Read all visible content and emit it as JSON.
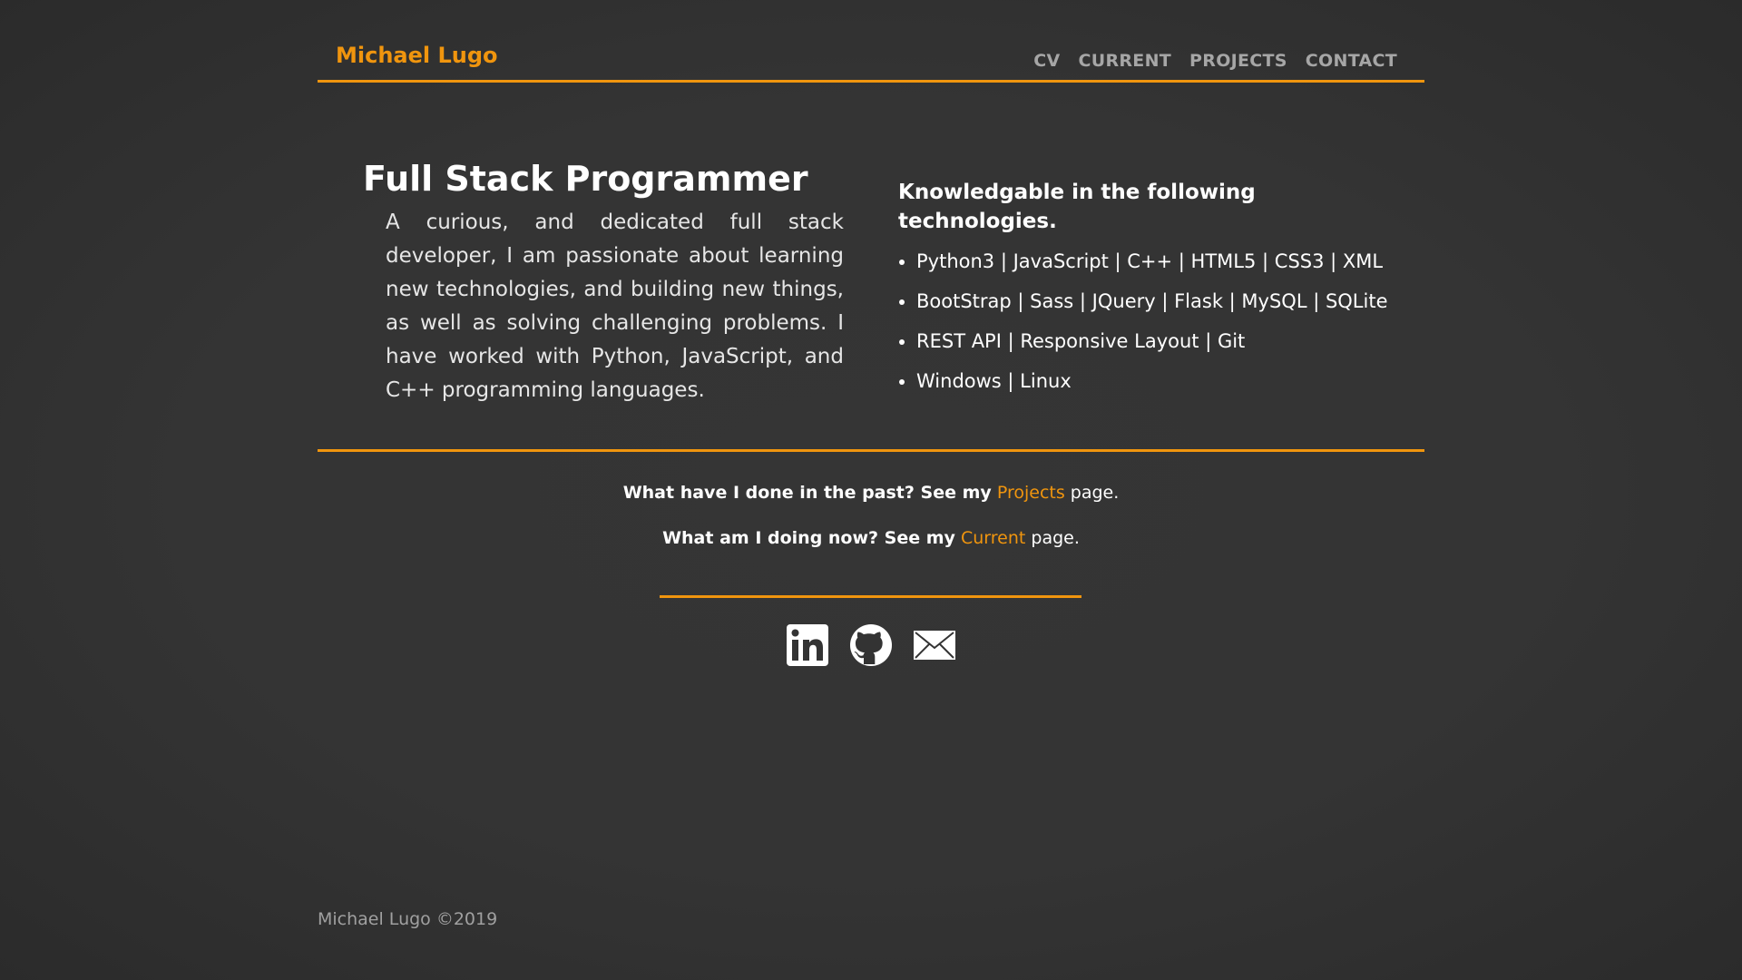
{
  "header": {
    "brand": "Michael Lugo",
    "nav": [
      "CV",
      "CURRENT",
      "PROJECTS",
      "CONTACT"
    ]
  },
  "intro": {
    "title": "Full Stack Programmer",
    "description": "A curious, and dedicated full stack developer, I am passionate about learning new technologies, and building new things, as well as solving challenging problems. I have worked with Python, JavaScript, and C++ programming languages."
  },
  "technologies": {
    "heading": "Knowledgable in the following technologies.",
    "items": [
      "Python3 | JavaScript | C++ | HTML5 | CSS3 | XML",
      "BootStrap | Sass | JQuery | Flask | MySQL | SQLite",
      "REST API | Responsive Layout | Git",
      "Windows | Linux"
    ]
  },
  "links": {
    "past": {
      "lead": "What have I done in the past? See my",
      "link": "Projects",
      "tail": "page."
    },
    "now": {
      "lead": "What am I doing now? See my",
      "link": "Current",
      "tail": "page."
    }
  },
  "social": {
    "icons": [
      "linkedin-icon",
      "github-icon",
      "mail-icon"
    ]
  },
  "footer": {
    "copyright": "Michael Lugo ©2019"
  },
  "colors": {
    "accent": "#f0950e",
    "background": "#333333",
    "nav_text": "#a6a6a6"
  }
}
